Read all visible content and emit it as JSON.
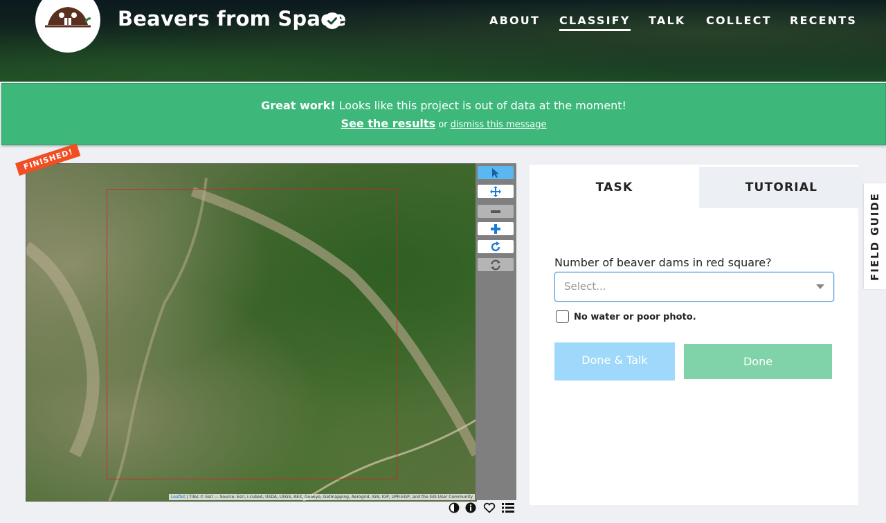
{
  "header": {
    "title": "Beavers from Space",
    "nav": [
      {
        "label": "ABOUT"
      },
      {
        "label": "CLASSIFY",
        "active": true
      },
      {
        "label": "TALK"
      },
      {
        "label": "COLLECT"
      },
      {
        "label": "RECENTS"
      }
    ]
  },
  "banner": {
    "bold": "Great work!",
    "message": "Looks like this project is out of data at the moment!",
    "results_link": "See the results",
    "or": "or",
    "dismiss_link": "dismiss this message"
  },
  "map": {
    "badge": "FINISHED!",
    "attribution_leaflet": "Leaflet",
    "attribution_text": "| Tiles © Esri — Source: Esri, i-cubed, USDA, USGS, AEX, GeoEye, Getmapping, Aerogrid, IGN, IGP, UPR-EGP, and the GIS User Community",
    "tools": [
      "pointer-icon",
      "move-icon",
      "zoom-out-icon",
      "zoom-in-icon",
      "rotate-icon",
      "reset-icon"
    ],
    "footer_icons": [
      "invert-colors-icon",
      "info-icon",
      "heart-icon",
      "collections-icon"
    ]
  },
  "task_panel": {
    "tabs": {
      "task": "TASK",
      "tutorial": "TUTORIAL"
    },
    "question": "Number of beaver dams in red square?",
    "select_placeholder": "Select...",
    "checkbox_label": "No water or poor photo.",
    "done_talk": "Done & Talk",
    "done": "Done"
  },
  "field_guide": "FIELD GUIDE",
  "colors": {
    "banner": "#3db87a",
    "badge": "#f04e23",
    "done_talk": "#9ed9fb",
    "done": "#80d3a9",
    "tool_selected": "#5ab7f0"
  }
}
